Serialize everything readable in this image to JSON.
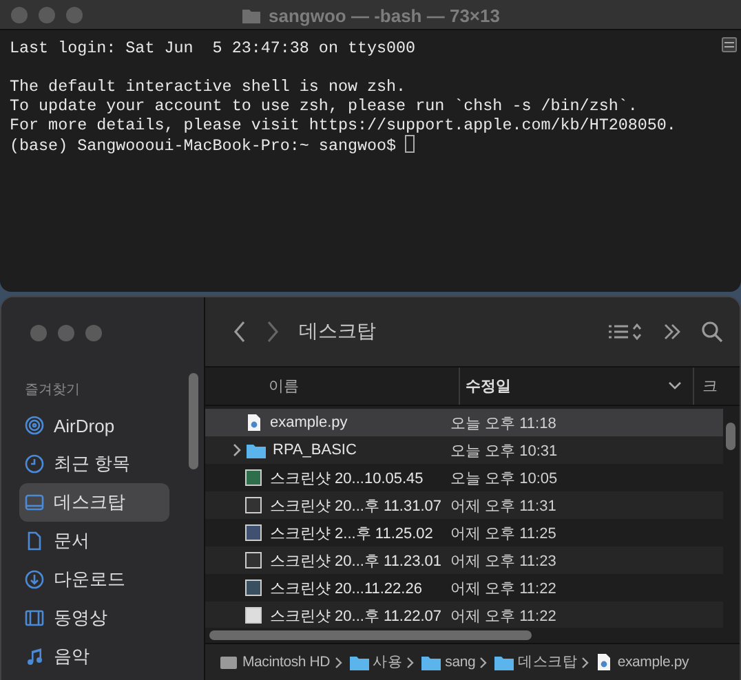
{
  "terminal": {
    "title": "sangwoo — -bash — 73×13",
    "login": "Last login: Sat Jun  5 23:47:38 on ttys000",
    "lines": [
      "The default interactive shell is now zsh.",
      "To update your account to use zsh, please run `chsh -s /bin/zsh`.",
      "For more details, please visit https://support.apple.com/kb/HT208050."
    ],
    "prompt": "(base) Sangwoooui-MacBook-Pro:~ sangwoo$"
  },
  "finder": {
    "title": "데스크탑",
    "sidebar": {
      "heading": "즐겨찾기",
      "items": [
        {
          "label": "AirDrop",
          "kind": "airdrop",
          "selected": false
        },
        {
          "label": "최근 항목",
          "kind": "recent",
          "selected": false
        },
        {
          "label": "데스크탑",
          "kind": "desktop",
          "selected": true
        },
        {
          "label": "문서",
          "kind": "document",
          "selected": false
        },
        {
          "label": "다운로드",
          "kind": "download",
          "selected": false
        },
        {
          "label": "동영상",
          "kind": "movie",
          "selected": false
        },
        {
          "label": "음악",
          "kind": "music",
          "selected": false
        }
      ]
    },
    "columns": [
      {
        "label": "이름",
        "sorted": false
      },
      {
        "label": "수정일",
        "sorted": true
      },
      {
        "label": "크",
        "sorted": false
      }
    ],
    "rows": [
      {
        "name": "example.py",
        "date": "오늘 오후 11:18",
        "kind": "python",
        "selected": true
      },
      {
        "name": "RPA_BASIC",
        "date": "오늘 오후 10:31",
        "kind": "folder",
        "selected": false
      },
      {
        "name": "스크린샷 20...10.05.45",
        "date": "오늘 오후 10:05",
        "kind": "image",
        "selected": false
      },
      {
        "name": "스크린샷 20...후 11.31.07",
        "date": "어제 오후 11:31",
        "kind": "image",
        "selected": false
      },
      {
        "name": "스크린샷 2...후 11.25.02",
        "date": "어제 오후 11:25",
        "kind": "image",
        "selected": false
      },
      {
        "name": "스크린샷 20...후 11.23.01",
        "date": "어제 오후 11:23",
        "kind": "image",
        "selected": false
      },
      {
        "name": "스크린샷 20...11.22.26",
        "date": "어제 오후 11:22",
        "kind": "image",
        "selected": false
      },
      {
        "name": "스크린샷 20...후 11.22.07",
        "date": "어제 오후 11:22",
        "kind": "image",
        "selected": false
      }
    ],
    "path": [
      {
        "label": "Macintosh HD",
        "kind": "disk"
      },
      {
        "label": "사용",
        "kind": "folder"
      },
      {
        "label": "sang",
        "kind": "folder"
      },
      {
        "label": "데스크탑",
        "kind": "folder"
      },
      {
        "label": "example.py",
        "kind": "python"
      }
    ]
  }
}
